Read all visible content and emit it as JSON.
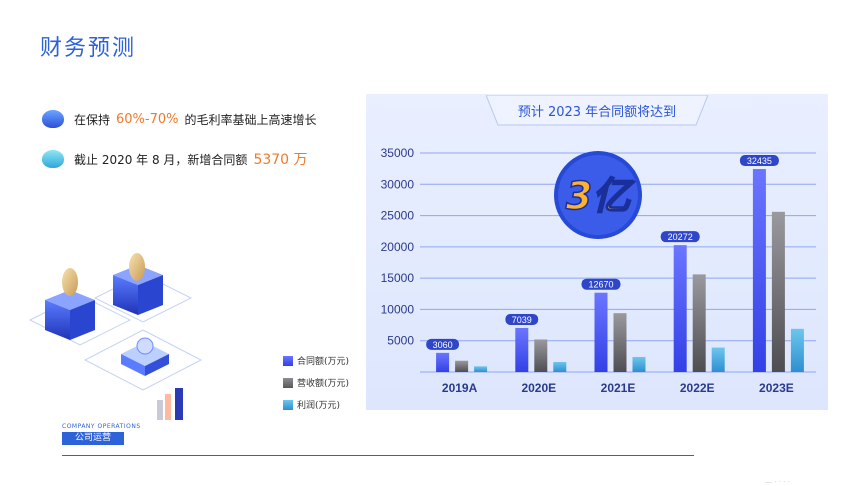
{
  "page_title": "财务预测",
  "bullets": [
    {
      "before": "在保持",
      "highlight": "60%-70%",
      "after": "的毛利率基础上高速增长"
    },
    {
      "before": "截止 2020 年 8 月，新增合同额",
      "highlight": "5370 万"
    }
  ],
  "banner": "预计 2023 年合同额将达到",
  "badge": "3亿",
  "legend": [
    {
      "label": "合同额(万元)",
      "color": "#4a55f0"
    },
    {
      "label": "营收额(万元)",
      "color": "#6e6e72"
    },
    {
      "label": "利润(万元)",
      "color": "#3aa0d8"
    }
  ],
  "footer": {
    "en": "COMPANY OPERATIONS",
    "cn": "公司运营"
  },
  "watermark": "— · · · ·",
  "chart_data": {
    "type": "bar",
    "categories": [
      "2019A",
      "2020E",
      "2021E",
      "2022E",
      "2023E"
    ],
    "series": [
      {
        "name": "合同额(万元)",
        "values": [
          3060,
          7039,
          12670,
          20272,
          32435
        ],
        "color": "#4a55f0"
      },
      {
        "name": "营收额(万元)",
        "values": [
          1800,
          5200,
          9400,
          15600,
          25600
        ],
        "color": "#6e6e72"
      },
      {
        "name": "利润(万元)",
        "values": [
          900,
          1600,
          2400,
          3900,
          6900
        ],
        "color": "#3aa0d8"
      }
    ],
    "data_labels": [
      "3060",
      "7039",
      "12670",
      "20272",
      "32435"
    ],
    "yticks": [
      "5000",
      "10000",
      "15000",
      "20000",
      "25000",
      "30000",
      "35000"
    ],
    "ylim": [
      0,
      35000
    ],
    "grid": true
  }
}
